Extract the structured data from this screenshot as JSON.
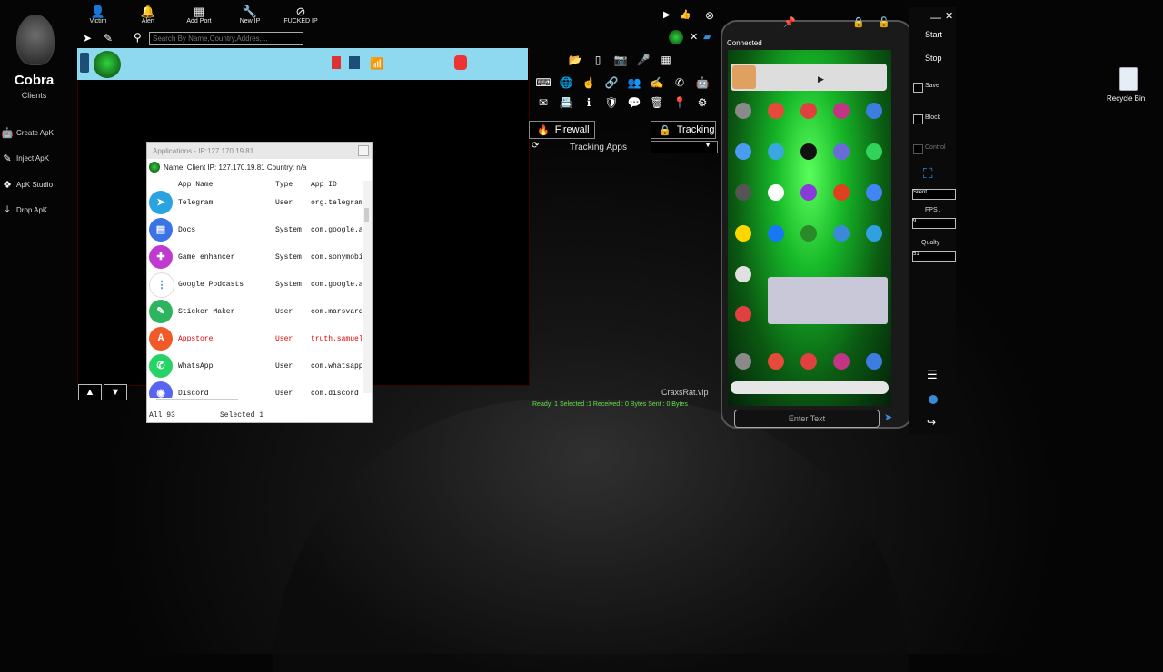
{
  "sidebar": {
    "brand": "Cobra",
    "subtitle": "Clients",
    "items": [
      {
        "label": "Create ApK",
        "icon": "android-icon"
      },
      {
        "label": "Inject ApK",
        "icon": "syringe-icon"
      },
      {
        "label": "ApK Studio",
        "icon": "dropbox-icon"
      },
      {
        "label": "Drop ApK",
        "icon": "download-icon"
      }
    ]
  },
  "toolbar": {
    "items": [
      {
        "label": "Victim",
        "icon": "user-icon"
      },
      {
        "label": "Alert",
        "icon": "bell-icon"
      },
      {
        "label": "Add Port",
        "icon": "grid-icon"
      },
      {
        "label": "New IP",
        "icon": "wrench-icon"
      },
      {
        "label": "FUCKED IP",
        "icon": "ban-icon"
      }
    ],
    "search_placeholder": "Search By Name,Country,Addres,..."
  },
  "apps_window": {
    "title": "Applications - IP:127.170.19.81",
    "info": "Name: Client  IP: 127.170.19.81  Country: n/a",
    "columns": [
      "App Name",
      "Type",
      "App ID"
    ],
    "rows": [
      {
        "name": "Telegram",
        "type": "User",
        "id": "org.telegram",
        "color": "#2aa3e0",
        "glyph": "➤"
      },
      {
        "name": "Docs",
        "type": "System",
        "id": "com.google.a",
        "color": "#3b73e6",
        "glyph": "▤"
      },
      {
        "name": "Game enhancer",
        "type": "System",
        "id": "com.sonymobi",
        "color": "#c03ad0",
        "glyph": "✚"
      },
      {
        "name": "Google Podcasts",
        "type": "System",
        "id": "com.google.a",
        "color": "#ffffff",
        "glyph": "⋮"
      },
      {
        "name": "Sticker Maker",
        "type": "User",
        "id": "com.marsvard",
        "color": "#2db55d",
        "glyph": "✎"
      },
      {
        "name": "Appstore",
        "type": "User",
        "id": "truth.samuel",
        "color": "#f05a28",
        "glyph": "A",
        "highlight": true
      },
      {
        "name": "WhatsApp",
        "type": "User",
        "id": "com.whatsapp",
        "color": "#25d366",
        "glyph": "✆"
      },
      {
        "name": "Discord",
        "type": "User",
        "id": "com.discord",
        "color": "#5865f2",
        "glyph": "◉"
      }
    ],
    "footer_all": "All 93",
    "footer_selected": "Selected 1"
  },
  "tools": {
    "firewall": "Firewall",
    "tracking": "Tracking",
    "tracking_apps": "Tracking Apps"
  },
  "status": {
    "brand": "CraxsRat.vip",
    "text": "Ready: 1    Selected :1    Received : 0 Bytes    Sent : 0 Bytes"
  },
  "phone": {
    "connected": "Connected",
    "enter_text_placeholder": "Enter Text"
  },
  "control": {
    "start": "Start",
    "stop": "Stop",
    "save": "Save",
    "block": "Block",
    "control": "Control",
    "mode": "Silent",
    "fps_label": "FPS .",
    "fps_value": "9",
    "quality_label": "Qualty",
    "quality_value": "51"
  },
  "desktop": {
    "recycle_bin": "Recycle Bin"
  },
  "colors": {
    "client_row": "#8fd9f0",
    "status_green": "#64e04a",
    "highlight_red": "#d00000"
  }
}
